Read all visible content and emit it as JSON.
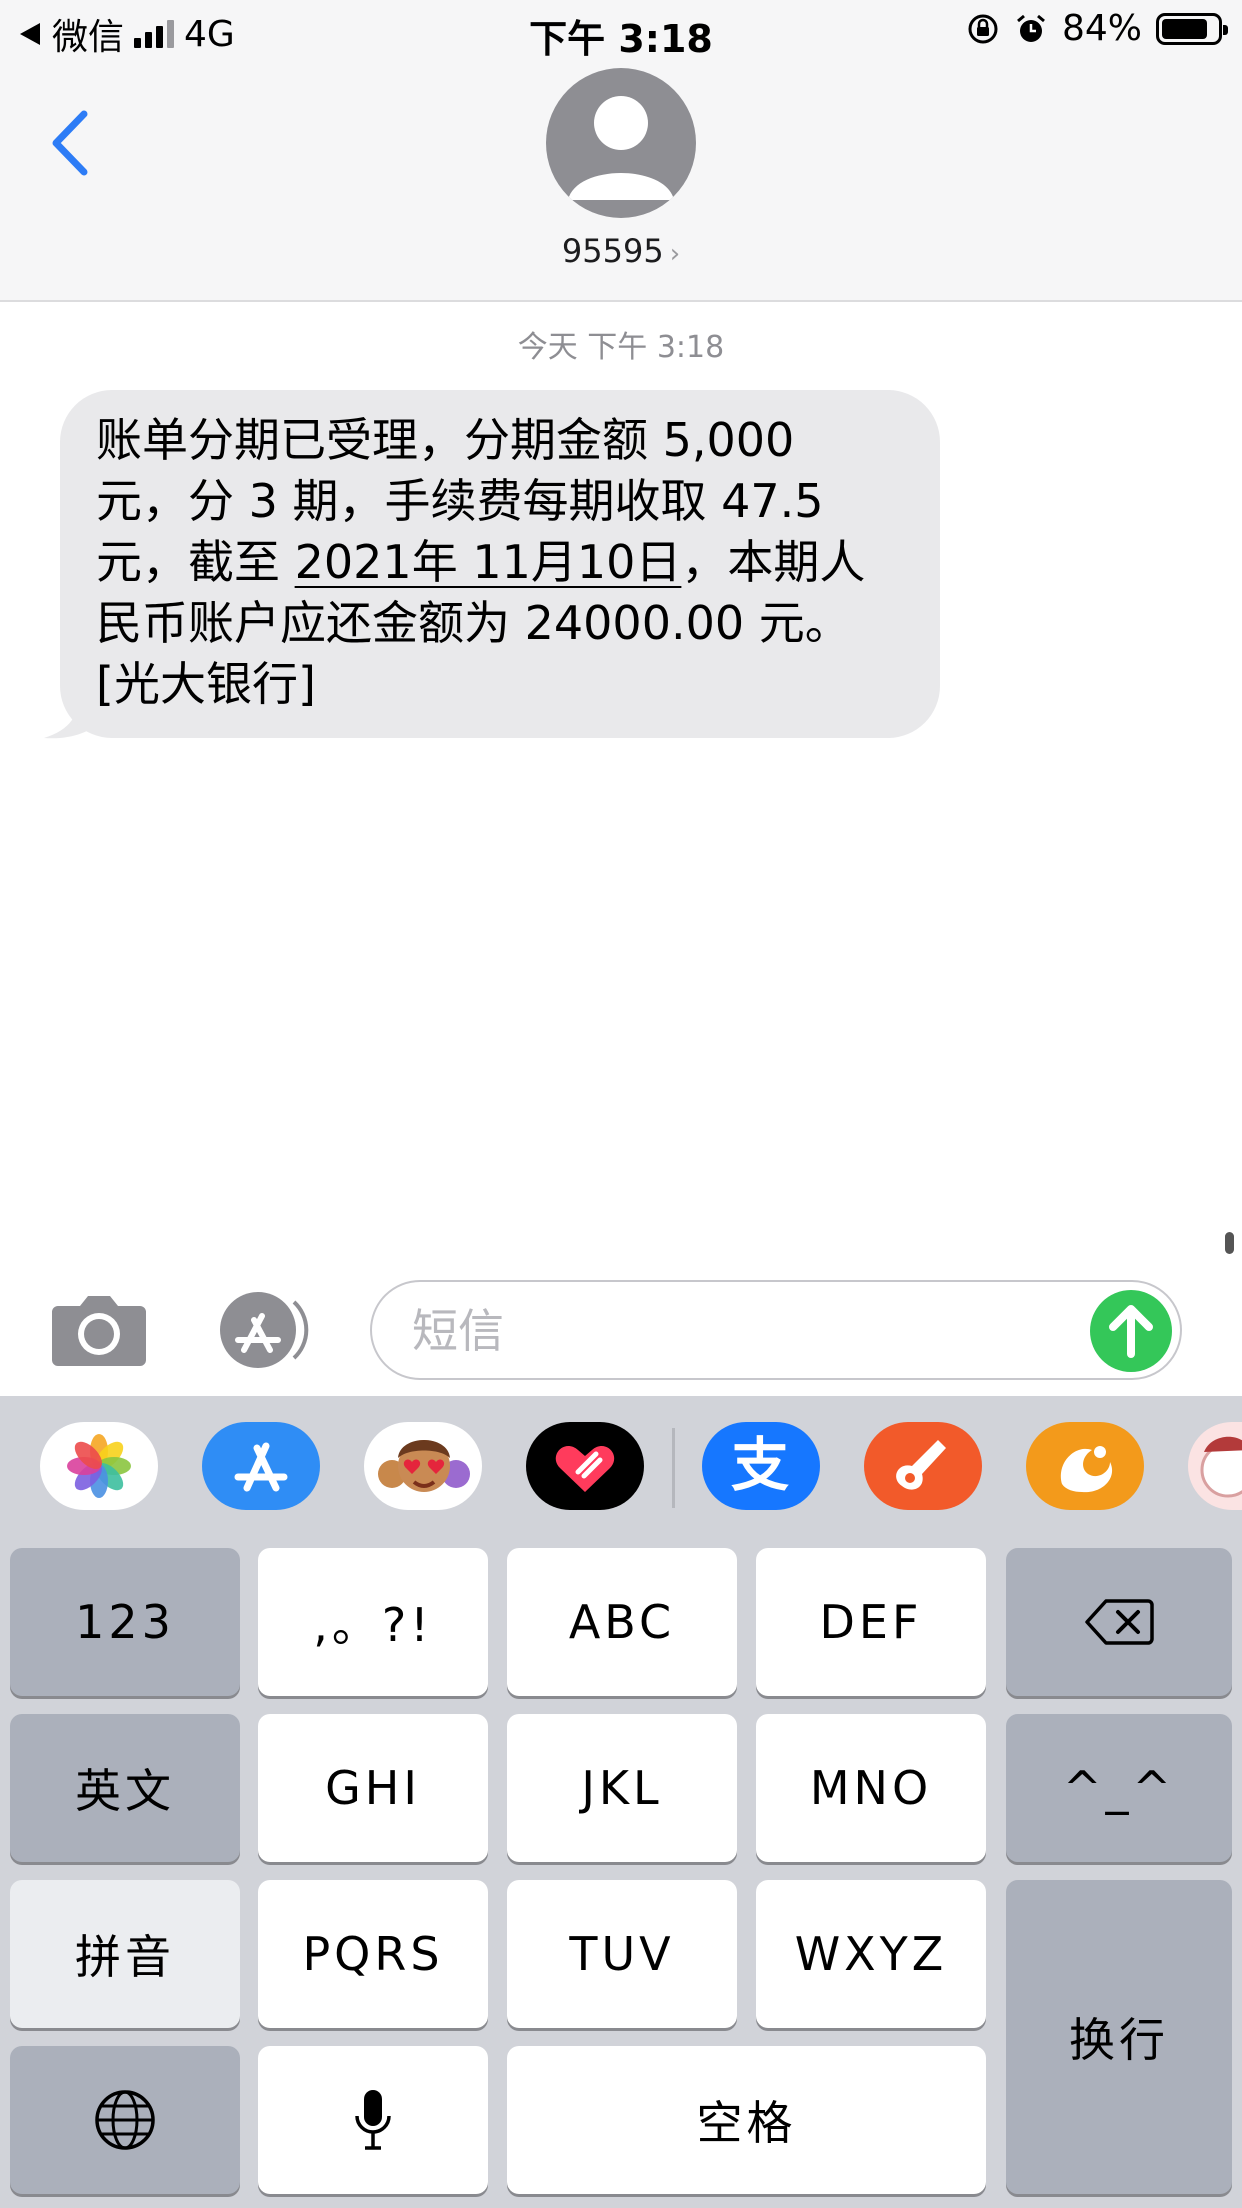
{
  "status_bar": {
    "back_app": "微信",
    "network": "4G",
    "time": "下午 3:18",
    "battery": "84%",
    "battery_level": 0.84
  },
  "nav": {
    "contact": "95595",
    "chevron": "›"
  },
  "conversation": {
    "timestamp": "今天 下午 3:18",
    "message": {
      "part1": "账单分期已受理，分期金额 5,000\n元，分 3 期，手续费每期收取 47.5\n元，截至 ",
      "date": "2021年 11月10日",
      "part2": "，本期人\n民币账户应还金额为 24000.00 元。\n[光大银行]"
    }
  },
  "composer": {
    "placeholder": "短信",
    "value": ""
  },
  "app_strip": {
    "icons": [
      "photos-app-icon",
      "app-store-icon",
      "memoji-icon",
      "digital-touch-icon",
      "alipay-icon",
      "garageband-icon",
      "uc-browser-icon",
      "sticker-app-icon"
    ],
    "alipay_glyph": "支"
  },
  "keyboard": {
    "row1": [
      "123",
      ",。?!",
      "ABC",
      "DEF"
    ],
    "row2": [
      "英文",
      "GHI",
      "JKL",
      "MNO",
      "^_^"
    ],
    "row3": [
      "拼音",
      "PQRS",
      "TUV",
      "WXYZ"
    ],
    "row4": {
      "space": "空格"
    },
    "return": "换行"
  },
  "colors": {
    "accent_blue": "#2d7cf6",
    "send_green": "#34c759",
    "bubble_gray": "#e9e9eb",
    "keyboard_bg": "#d1d3d9"
  }
}
